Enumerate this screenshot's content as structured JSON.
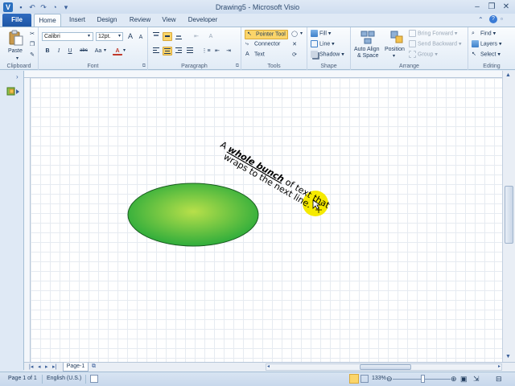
{
  "window": {
    "title": "Drawing5 - Microsoft Visio",
    "app_icon": "V"
  },
  "quick_access": [
    {
      "name": "save-icon",
      "glyph": "▪"
    },
    {
      "name": "undo-icon",
      "glyph": "↶"
    },
    {
      "name": "redo-icon",
      "glyph": "↷"
    },
    {
      "name": "print-preview-icon",
      "glyph": "◔"
    },
    {
      "name": "customize-qat-icon",
      "glyph": "▾"
    }
  ],
  "window_controls": {
    "minimize": "–",
    "restore": "❐",
    "close": "✕"
  },
  "tabs": {
    "file": "File",
    "home": "Home",
    "insert": "Insert",
    "design": "Design",
    "review": "Review",
    "view": "View",
    "developer": "Developer",
    "active": "Home"
  },
  "ribbon": {
    "clipboard": {
      "label": "Clipboard",
      "paste": "Paste"
    },
    "font": {
      "label": "Font",
      "family": "Calibri",
      "size": "12pt.",
      "bold": "B",
      "italic": "I",
      "underline": "U",
      "strike": "abc",
      "case": "Aa",
      "color": "A",
      "grow": "A",
      "shrink": "A"
    },
    "paragraph": {
      "label": "Paragraph"
    },
    "tools": {
      "label": "Tools",
      "pointer": "Pointer Tool",
      "connector": "Connector",
      "text": "Text"
    },
    "shape": {
      "label": "Shape",
      "fill": "Fill",
      "line": "Line",
      "shadow": "Shadow"
    },
    "arrange": {
      "label": "Arrange",
      "auto_align": "Auto Align",
      "auto_align_2": "& Space",
      "position": "Position",
      "bring_forward": "Bring Forward",
      "send_backward": "Send Backward",
      "group": "Group"
    },
    "editing": {
      "label": "Editing",
      "find": "Find",
      "layers": "Layers",
      "select": "Select"
    }
  },
  "drawing": {
    "text_line1_prefix": "A ",
    "text_line1_emph": "whole bunch",
    "text_line1_suffix": " of text that",
    "text_line2": "wraps to the next line.",
    "ellipse_gradient_center": "#b8e04a",
    "ellipse_gradient_edge": "#22a83a",
    "highlight_color": "#f5ea00"
  },
  "page_tabs": {
    "page1": "Page-1"
  },
  "status": {
    "page": "Page 1 of 1",
    "language": "English (U.S.)",
    "zoom": "133%",
    "zoom_level": 0.51
  }
}
